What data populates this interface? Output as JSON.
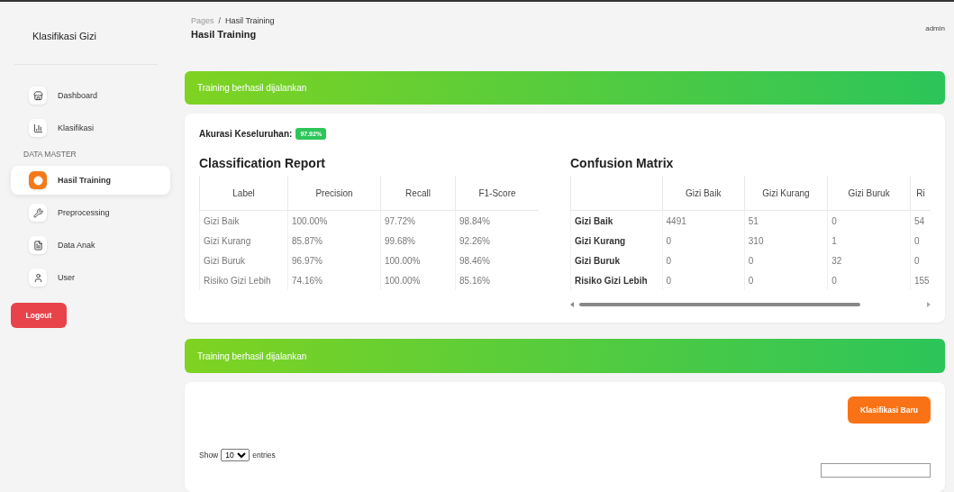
{
  "sidebar": {
    "brand": "Klasifikasi Gizi",
    "items": [
      {
        "kind": "item",
        "label": "Dashboard",
        "selected": false
      },
      {
        "kind": "item",
        "label": "Klasifikasi",
        "selected": false
      },
      {
        "kind": "section",
        "label": "DATA MASTER"
      },
      {
        "kind": "item",
        "label": "Hasil Training",
        "selected": true
      },
      {
        "kind": "item",
        "label": "Preprocessing",
        "selected": false
      },
      {
        "kind": "item",
        "label": "Data Anak",
        "selected": false
      },
      {
        "kind": "item",
        "label": "User",
        "selected": false
      }
    ],
    "logout": "Logout"
  },
  "header": {
    "breadcrumb": [
      {
        "kind": "link",
        "text": "Pages"
      },
      {
        "kind": "separator",
        "text": "/"
      },
      {
        "kind": "current",
        "text": "Hasil Training"
      }
    ],
    "title": "Hasil Training",
    "user": "admin"
  },
  "alert_top": "Training berhasil dijalankan",
  "accuracy": {
    "label": "Akurasi Keseluruhan:",
    "value": "97.92%"
  },
  "report": {
    "title": "Classification Report",
    "columns": [
      "Label",
      "Precision",
      "Recall",
      "F1-Score"
    ],
    "rows": [
      [
        "Gizi Baik",
        "100.00%",
        "97.72%",
        "98.84%"
      ],
      [
        "Gizi Kurang",
        "85.87%",
        "99.68%",
        "92.26%"
      ],
      [
        "Gizi Buruk",
        "96.97%",
        "100.00%",
        "98.46%"
      ],
      [
        "Risiko Gizi Lebih",
        "74.16%",
        "100.00%",
        "85.16%"
      ]
    ]
  },
  "matrix": {
    "title": "Confusion Matrix",
    "columns": [
      "Gizi Baik",
      "Gizi Kurang",
      "Gizi Buruk",
      "Ri"
    ],
    "rows": [
      {
        "label": "Gizi Baik",
        "cells": [
          "4491",
          "51",
          "0",
          "54"
        ]
      },
      {
        "label": "Gizi Kurang",
        "cells": [
          "0",
          "310",
          "1",
          "0"
        ]
      },
      {
        "label": "Gizi Buruk",
        "cells": [
          "0",
          "0",
          "32",
          "0"
        ]
      },
      {
        "label": "Risiko Gizi Lebih",
        "cells": [
          "0",
          "0",
          "0",
          "155"
        ]
      }
    ]
  },
  "alert_bottom": "Training berhasil dijalankan",
  "bottom": {
    "button": "Klasifikasi Baru",
    "show": "Show",
    "entries_value": "10",
    "entries": "entries"
  }
}
